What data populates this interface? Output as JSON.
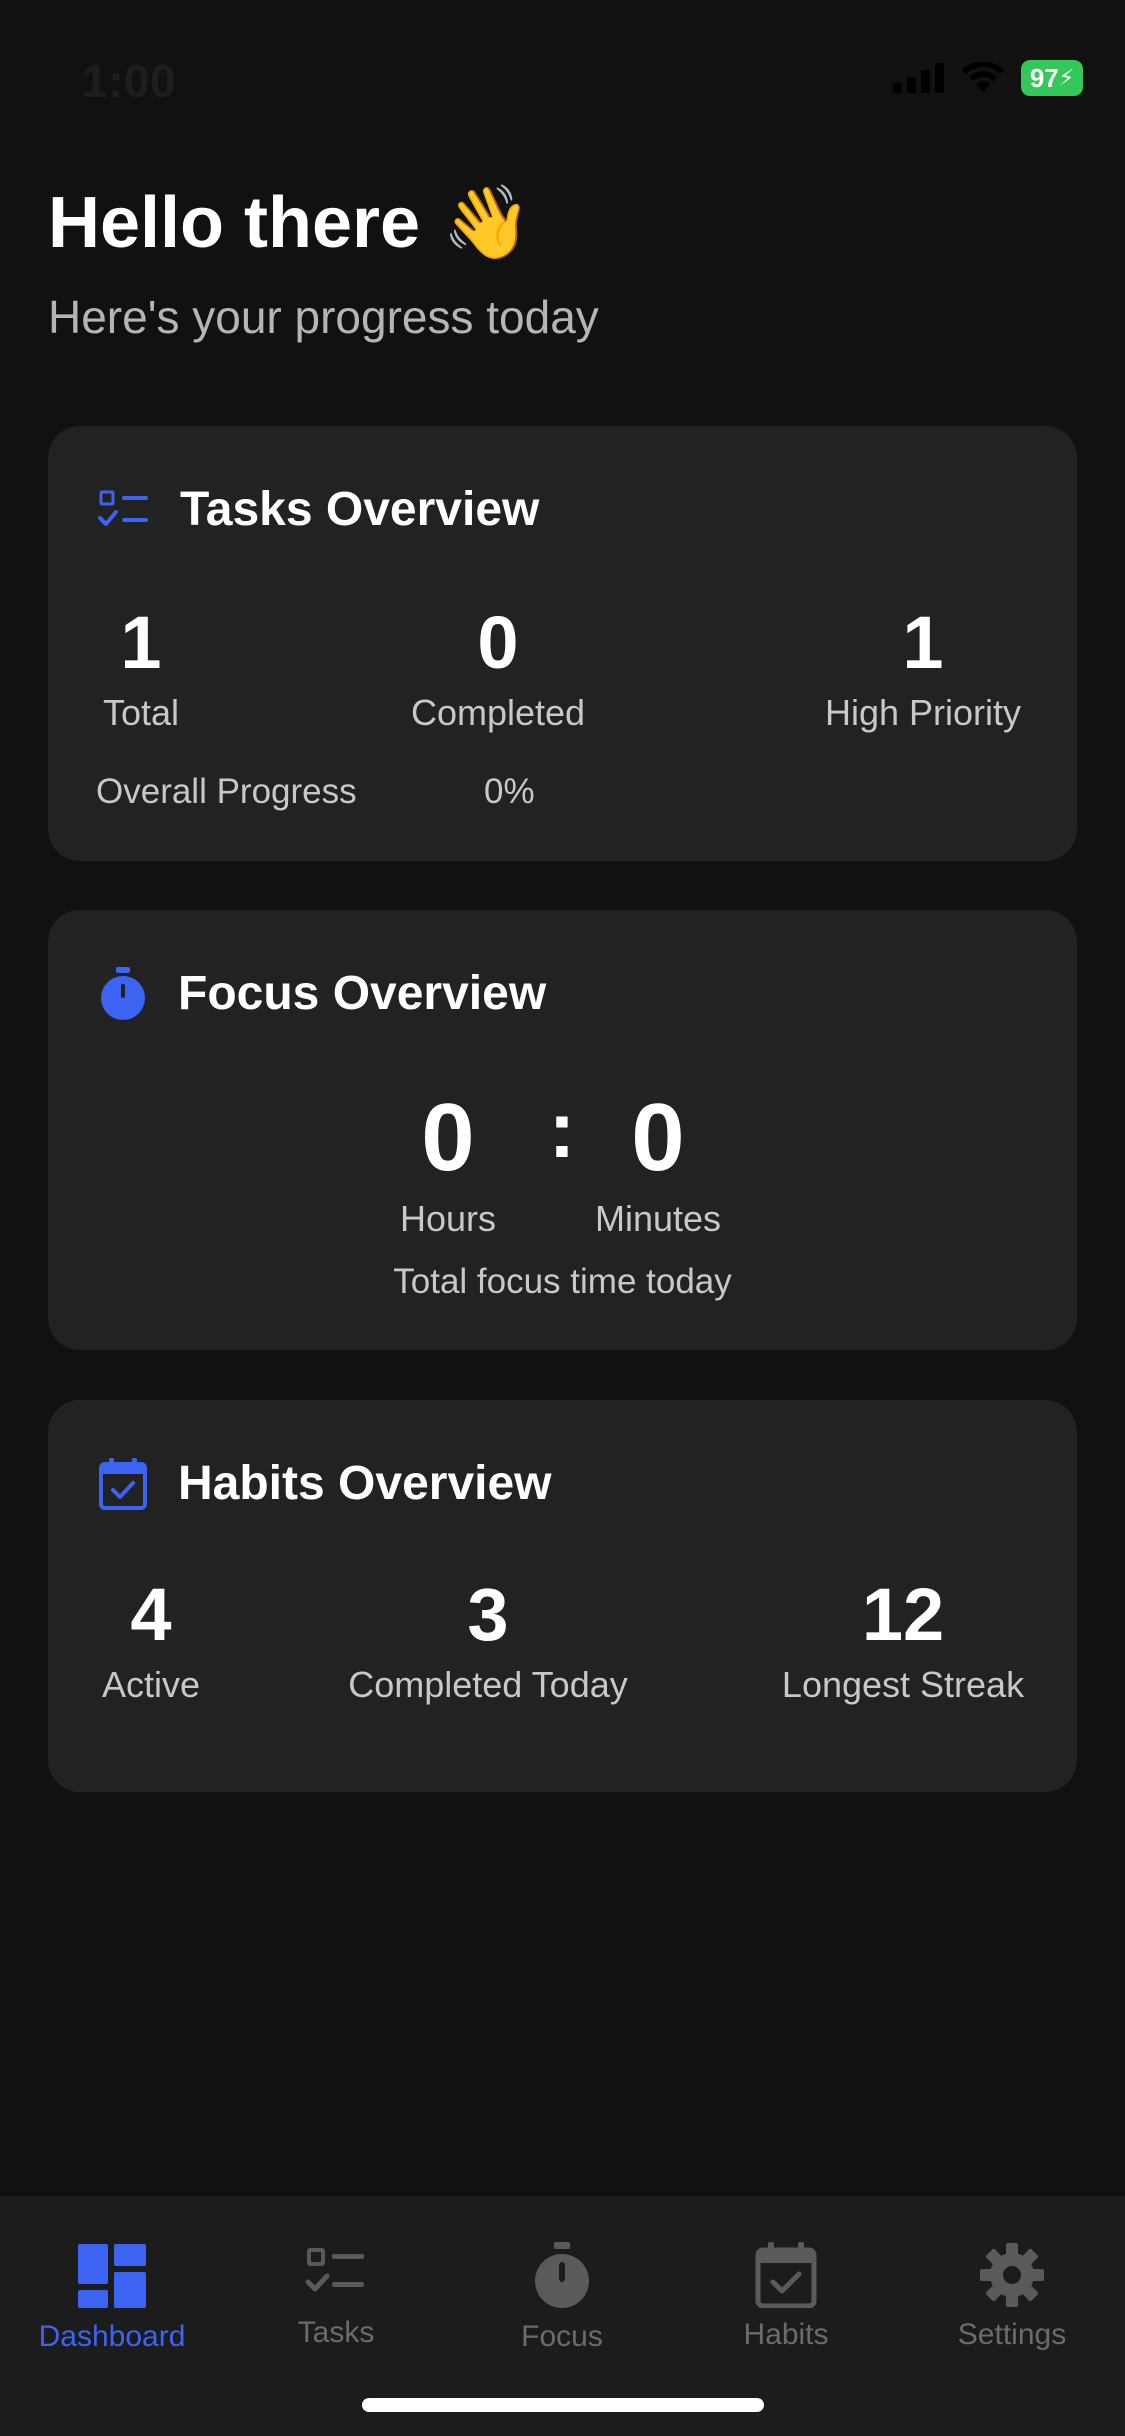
{
  "status_bar": {
    "time": "1:00",
    "battery": "97"
  },
  "greeting": {
    "title": "Hello there",
    "emoji": "👋",
    "subtitle": "Here's your progress today"
  },
  "tasks_card": {
    "title": "Tasks Overview",
    "stats": [
      {
        "value": "1",
        "label": "Total"
      },
      {
        "value": "0",
        "label": "Completed"
      },
      {
        "value": "1",
        "label": "High Priority"
      }
    ],
    "progress_label": "Overall Progress",
    "progress_value": "0%"
  },
  "focus_card": {
    "title": "Focus Overview",
    "hours_value": "0",
    "separator": ":",
    "minutes_value": "0",
    "hours_label": "Hours",
    "minutes_label": "Minutes",
    "caption": "Total focus time today"
  },
  "habits_card": {
    "title": "Habits Overview",
    "stats": [
      {
        "value": "4",
        "label": "Active"
      },
      {
        "value": "3",
        "label": "Completed Today"
      },
      {
        "value": "12",
        "label": "Longest Streak"
      }
    ]
  },
  "nav": {
    "items": [
      {
        "label": "Dashboard",
        "icon": "dashboard-icon",
        "active": true
      },
      {
        "label": "Tasks",
        "icon": "tasks-icon",
        "active": false
      },
      {
        "label": "Focus",
        "icon": "stopwatch-icon",
        "active": false
      },
      {
        "label": "Habits",
        "icon": "calendar-check-icon",
        "active": false
      },
      {
        "label": "Settings",
        "icon": "gear-icon",
        "active": false
      }
    ]
  },
  "colors": {
    "accent": "#3d63f2",
    "background": "#111111",
    "card": "#222222",
    "inactive": "#6b6b6b",
    "battery": "#34c759"
  }
}
